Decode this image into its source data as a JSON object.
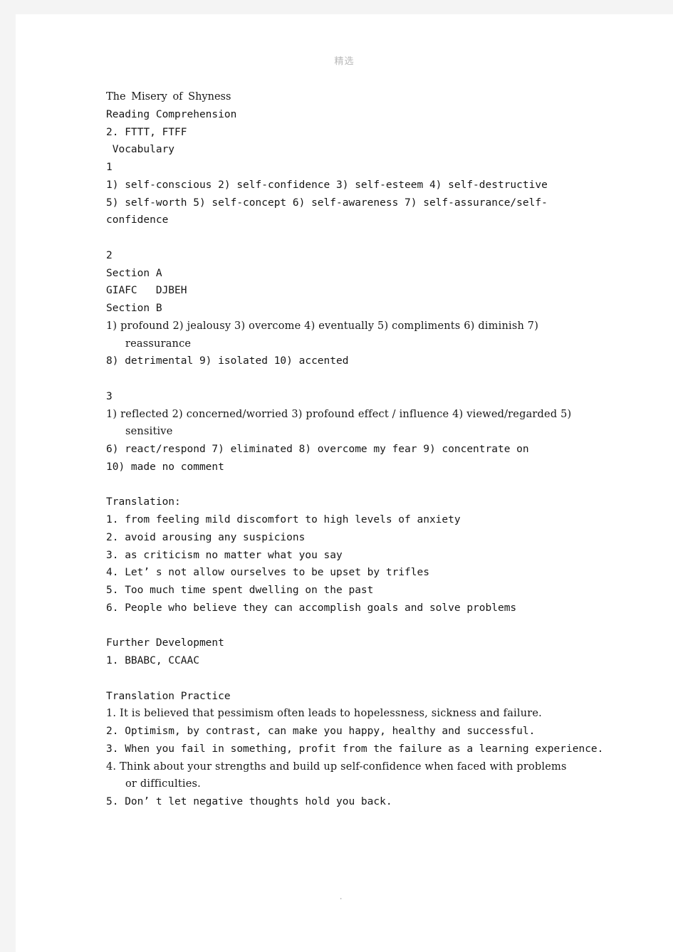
{
  "page": {
    "header_watermark": "精选",
    "footer_mark": "."
  },
  "document": {
    "title": "The Misery of Shyness",
    "lines": [
      {
        "id": "title",
        "text": "The Misery of Shyness",
        "style": "title"
      },
      {
        "id": "reading-heading",
        "text": "Reading Comprehension",
        "style": "mono"
      },
      {
        "id": "reading-answers",
        "text": "2. FTTT, FTFF",
        "style": "mono"
      },
      {
        "id": "vocabulary-heading",
        "text": " Vocabulary",
        "style": "mono"
      },
      {
        "id": "vocab-ex-1",
        "text": "1",
        "style": "mono"
      },
      {
        "id": "vocab-answers-a",
        "text": "1) self-conscious         2) self-confidence    3) self-esteem             4) self-destructive",
        "style": "mono-wrap"
      },
      {
        "id": "vocab-answers-b",
        "text": "5)  self-worth         5)  self-concept      6)  self-awareness           7) self-assurance/self-confidence",
        "style": "mono-wrap"
      },
      {
        "id": "spacer-1",
        "text": "",
        "style": "blank"
      },
      {
        "id": "ex-2",
        "text": "2",
        "style": "mono"
      },
      {
        "id": "section-a-heading",
        "text": "Section A",
        "style": "mono"
      },
      {
        "id": "section-a-answers",
        "text": "GIAFC   DJBEH",
        "style": "mono"
      },
      {
        "id": "section-b-heading",
        "text": "Section B",
        "style": "mono"
      },
      {
        "id": "section-b-line-1",
        "text": "1)  profound 2)  jealousy 3)  overcome 4)  eventually 5)  compliments 6)  diminish 7)  reassurance",
        "style": "serif-hang"
      },
      {
        "id": "section-b-line-2",
        "text": "8) detrimental 9) isolated 10) accented",
        "style": "mono"
      },
      {
        "id": "spacer-2",
        "text": "",
        "style": "blank"
      },
      {
        "id": "ex-3",
        "text": "3",
        "style": "mono"
      },
      {
        "id": "ex-3-line-1",
        "text": "1)  reflected 2) concerned/worried 3) profound effect / influence 4) viewed/regarded 5) sensitive",
        "style": "serif-hang"
      },
      {
        "id": "ex-3-line-2",
        "text": "6) react/respond 7) eliminated 8) overcome my fear 9) concentrate on",
        "style": "mono"
      },
      {
        "id": "ex-3-line-3",
        "text": "10) made no comment",
        "style": "mono"
      },
      {
        "id": "spacer-3",
        "text": "",
        "style": "blank"
      },
      {
        "id": "translation-heading",
        "text": "Translation:",
        "style": "mono"
      },
      {
        "id": "translation-1",
        "text": "1. from feeling mild discomfort to high levels of anxiety",
        "style": "mono"
      },
      {
        "id": "translation-2",
        "text": "2. avoid arousing any suspicions",
        "style": "mono"
      },
      {
        "id": "translation-3",
        "text": "3. as criticism no matter what you say",
        "style": "mono"
      },
      {
        "id": "translation-4",
        "text": "4. Let’ s not allow ourselves to be upset by trifles",
        "style": "mono"
      },
      {
        "id": "translation-5",
        "text": "5. Too much time spent dwelling on the past",
        "style": "mono"
      },
      {
        "id": "translation-6",
        "text": "6. People who believe they can accomplish goals and solve problems",
        "style": "mono"
      },
      {
        "id": "spacer-4",
        "text": "",
        "style": "blank"
      },
      {
        "id": "further-dev-heading",
        "text": "Further Development",
        "style": "mono"
      },
      {
        "id": "further-dev-1",
        "text": "1. BBABC, CCAAC",
        "style": "mono"
      },
      {
        "id": "spacer-5",
        "text": "",
        "style": "blank"
      },
      {
        "id": "translation-practice-heading",
        "text": "Translation Practice",
        "style": "mono"
      },
      {
        "id": "practice-1",
        "text": "1. It is believed that pessimism often leads to hopelessness, sickness and failure.",
        "style": "serif-hang"
      },
      {
        "id": "practice-2",
        "text": "2. Optimism, by contrast, can make you happy, healthy and successful.",
        "style": "mono"
      },
      {
        "id": "practice-3",
        "text": "3. When you fail in something, profit from the failure as a learning experience.",
        "style": "mono"
      },
      {
        "id": "practice-4",
        "text": "4. Think about your strengths and build up self-confidence when faced with problems or difficulties.",
        "style": "serif-hang"
      },
      {
        "id": "practice-5",
        "text": "5. Don’ t let negative thoughts hold you back.",
        "style": "mono"
      }
    ]
  }
}
